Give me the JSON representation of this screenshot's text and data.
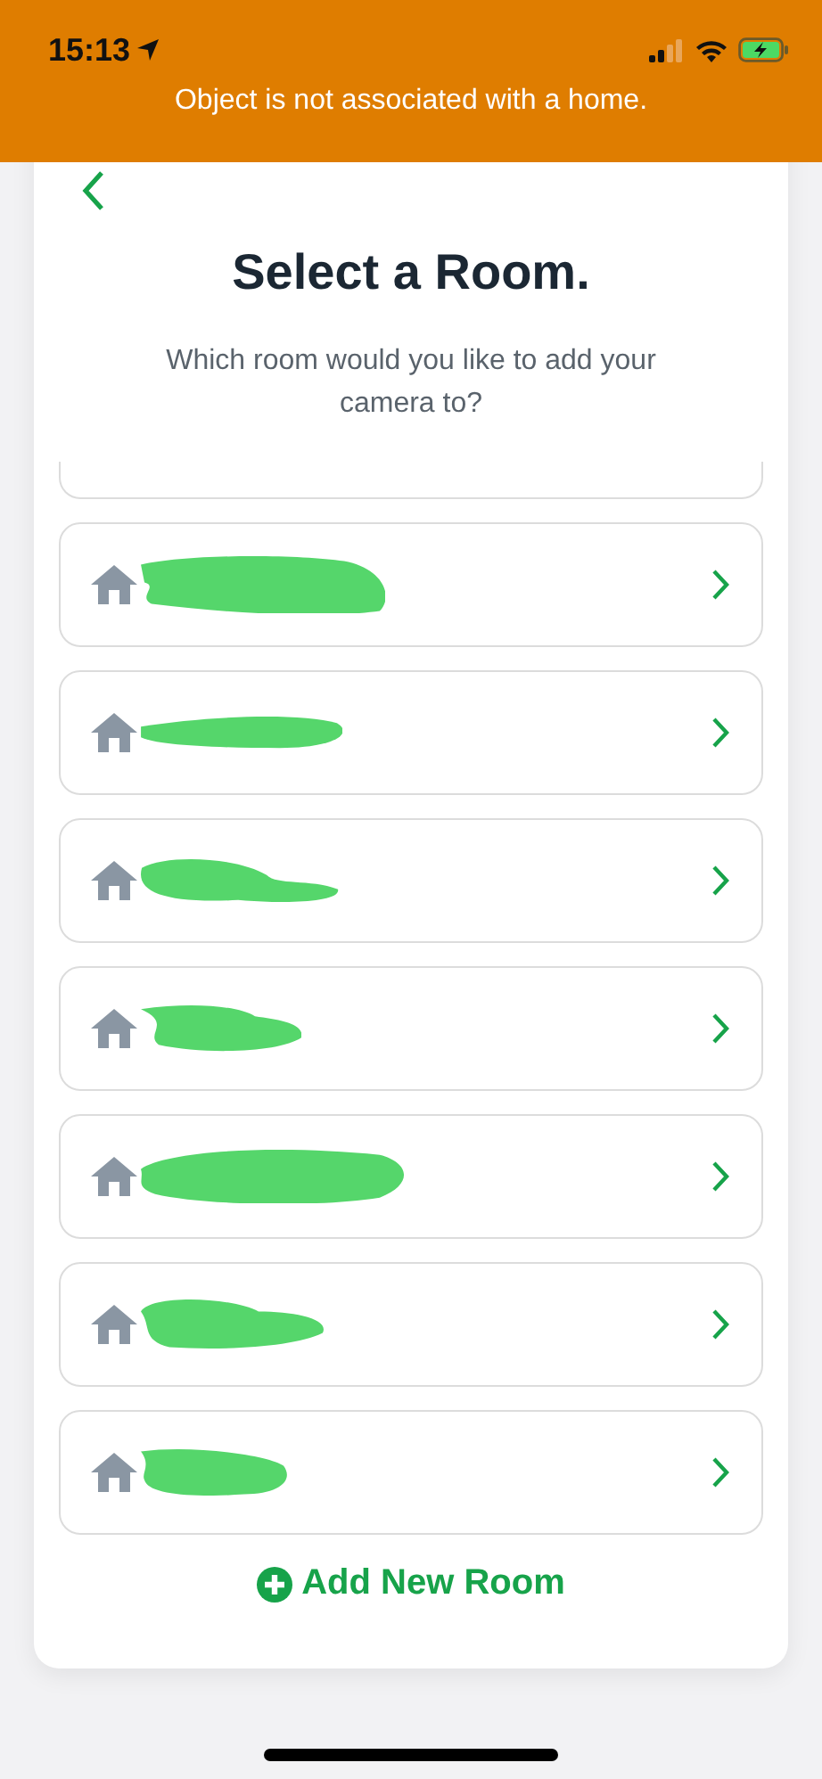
{
  "status_bar": {
    "time": "15:13"
  },
  "banner": {
    "message": "Object is not associated with a home."
  },
  "header": {
    "title": "Select a Room.",
    "subtitle": "Which room would you like to add your camera to?"
  },
  "rooms": [
    {
      "redacted": true
    },
    {
      "redacted": true
    },
    {
      "redacted": true
    },
    {
      "redacted": true
    },
    {
      "redacted": true
    },
    {
      "redacted": true
    },
    {
      "redacted": true
    }
  ],
  "add_button": {
    "label": "Add New Room"
  }
}
